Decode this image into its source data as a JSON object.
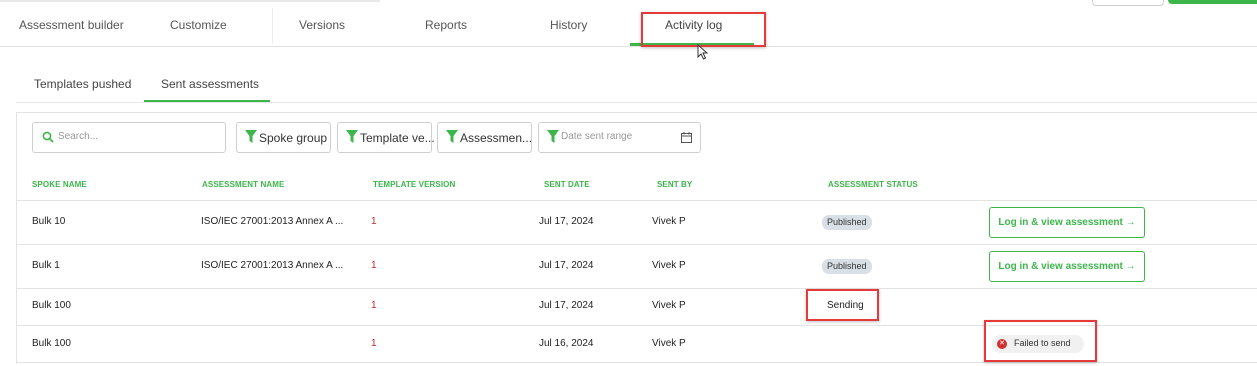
{
  "main_tabs": [
    {
      "label": "Assessment builder"
    },
    {
      "label": "Customize"
    },
    {
      "label": "Versions"
    },
    {
      "label": "Reports"
    },
    {
      "label": "History"
    },
    {
      "label": "Activity log",
      "active": true
    }
  ],
  "sub_tabs": [
    {
      "label": "Templates pushed"
    },
    {
      "label": "Sent assessments",
      "active": true
    }
  ],
  "filters": {
    "search_placeholder": "Search...",
    "spoke_group": "Spoke group",
    "template_version": "Template ve...",
    "assessment": "Assessmen...",
    "date_placeholder": "Date sent range"
  },
  "table": {
    "headers": [
      "SPOKE NAME",
      "ASSESSMENT NAME",
      "TEMPLATE VERSION",
      "SENT DATE",
      "SENT BY",
      "ASSESSMENT STATUS"
    ],
    "rows": [
      {
        "spoke": "Bulk 10",
        "assessment": "ISO/IEC 27001:2013 Annex A ...",
        "version": "1",
        "date": "Jul 17, 2024",
        "sent_by": "Vivek P",
        "status": "Published",
        "action": "Log in & view assessment →"
      },
      {
        "spoke": "Bulk 1",
        "assessment": "ISO/IEC 27001:2013 Annex A ...",
        "version": "1",
        "date": "Jul 17, 2024",
        "sent_by": "Vivek P",
        "status": "Published",
        "action": "Log in & view assessment →"
      },
      {
        "spoke": "Bulk 100",
        "assessment": "",
        "version": "1",
        "date": "Jul 17, 2024",
        "sent_by": "Vivek P",
        "status": "Sending",
        "action": ""
      },
      {
        "spoke": "Bulk 100",
        "assessment": "",
        "version": "1",
        "date": "Jul 16, 2024",
        "sent_by": "Vivek P",
        "status": "",
        "action": "Failed to send"
      }
    ]
  },
  "colors": {
    "accent": "#3cb64b",
    "highlight": "#e5393a",
    "error": "#d32f2f",
    "version_text": "#c62828"
  },
  "icons": [
    "search-icon",
    "filter-icon",
    "calendar-icon",
    "error-icon",
    "mouse-cursor-icon"
  ]
}
